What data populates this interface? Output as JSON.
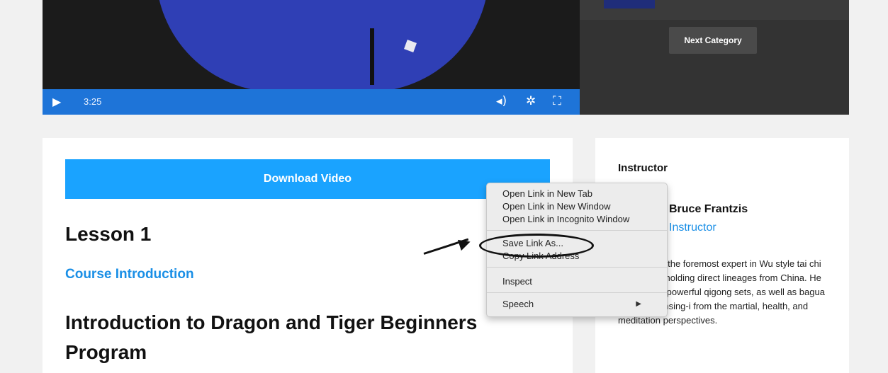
{
  "video": {
    "time": "3:25",
    "icons": [
      "play-icon",
      "volume-icon",
      "settings-icon",
      "fullscreen-icon"
    ]
  },
  "sidebar_video": {
    "next_category_label": "Next Category"
  },
  "main": {
    "download_label": "Download Video",
    "lesson_title": "Lesson 1",
    "course_link": "Course Introduction",
    "program_title": "Introduction to Dragon and Tiger Beginners Program"
  },
  "instructor": {
    "heading": "Instructor",
    "name": "Bruce Frantzis",
    "role": "Instructor",
    "bio": "been called the foremost expert in Wu style tai chi and tai chi, holding direct lineages from China. He teaches six powerful qigong sets, as well as bagua zhang and hsing-i from the martial, health, and meditation perspectives."
  },
  "context_menu": {
    "items": [
      "Open Link in New Tab",
      "Open Link in New Window",
      "Open Link in Incognito Window",
      "Save Link As...",
      "Copy Link Address",
      "Inspect",
      "Speech"
    ]
  },
  "colors": {
    "control_bar": "#1e74d8",
    "download_button": "#1aa3ff",
    "link": "#1a8fe6",
    "jacket": "#2f3fb5"
  }
}
